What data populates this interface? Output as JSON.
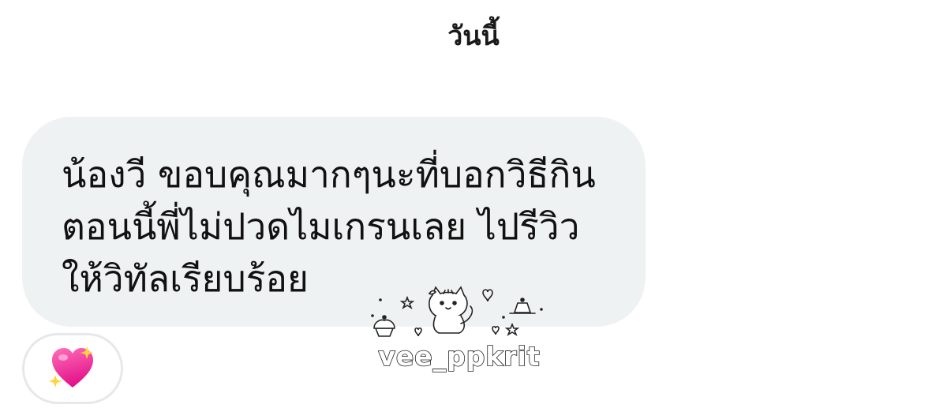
{
  "conversation": {
    "date_label": "วันนี้"
  },
  "message": {
    "text": "น้องวี ขอบคุณมากๆนะที่บอกวิธีกิน\nตอนนี้พี่ไม่ปวดไมเกรนเลย ไปรีวิว\nให้วิทัลเรียบร้อย",
    "bubble_color": "#eff2f3",
    "reaction_emoji": "💖",
    "reaction_icon": "sparkling-heart-icon"
  },
  "watermark": {
    "text": "vee_ppkrit",
    "mascot_icon": "cat-mascot-icon"
  }
}
